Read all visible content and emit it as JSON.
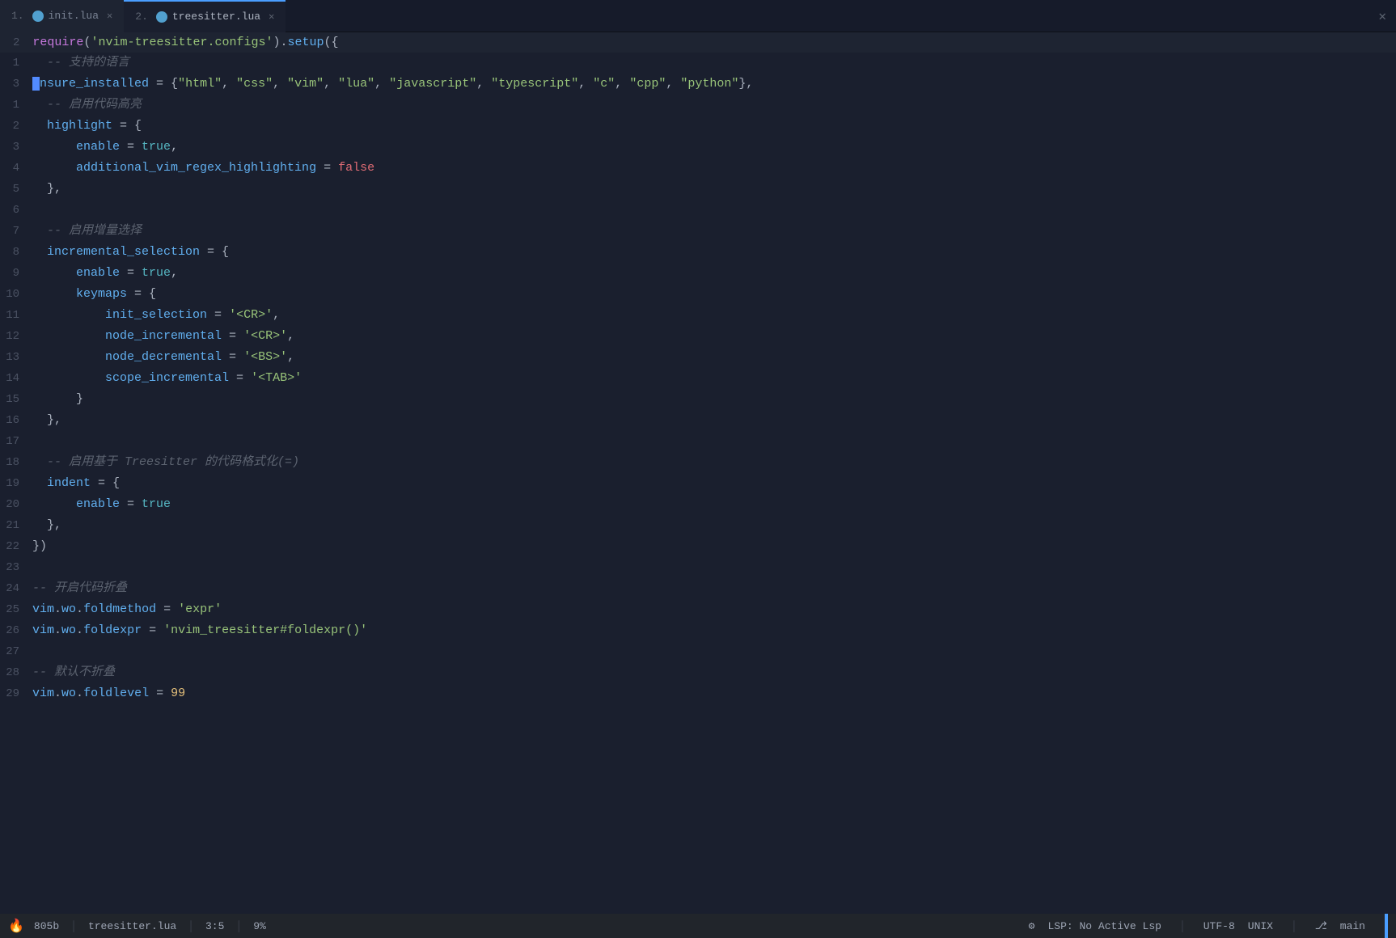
{
  "tabs": [
    {
      "id": "tab1",
      "number": "1.",
      "icon_color": "#51a0cf",
      "label": "init.lua",
      "active": false
    },
    {
      "id": "tab2",
      "number": "2.",
      "icon_color": "#51a0cf",
      "label": "treesitter.lua",
      "active": true
    }
  ],
  "require_line": "require('nvim-treesitter.configs').setup({",
  "code_lines": [
    {
      "num": "1",
      "content": "  -- 支持的语言"
    },
    {
      "num": "3",
      "content": "  ensure_installed = {\"html\", \"css\", \"vim\", \"lua\", \"javascript\", \"typescript\", \"c\", \"cpp\", \"python\"},"
    },
    {
      "num": "1",
      "content": "  -- 启用代码高亮"
    },
    {
      "num": "2",
      "content": "  highlight = {"
    },
    {
      "num": "3",
      "content": "      enable = true,"
    },
    {
      "num": "4",
      "content": "      additional_vim_regex_highlighting = false"
    },
    {
      "num": "5",
      "content": "  },"
    },
    {
      "num": "6",
      "content": ""
    },
    {
      "num": "7",
      "content": "  -- 启用增量选择"
    },
    {
      "num": "8",
      "content": "  incremental_selection = {"
    },
    {
      "num": "9",
      "content": "      enable = true,"
    },
    {
      "num": "10",
      "content": "      keymaps = {"
    },
    {
      "num": "11",
      "content": "          init_selection = '<CR>',"
    },
    {
      "num": "12",
      "content": "          node_incremental = '<CR>',"
    },
    {
      "num": "13",
      "content": "          node_decremental = '<BS>',"
    },
    {
      "num": "14",
      "content": "          scope_incremental = '<TAB>'"
    },
    {
      "num": "15",
      "content": "      }"
    },
    {
      "num": "16",
      "content": "  },"
    },
    {
      "num": "17",
      "content": ""
    },
    {
      "num": "18",
      "content": "  -- 启用基于 Treesitter 的代码格式化(=)"
    },
    {
      "num": "19",
      "content": "  indent = {"
    },
    {
      "num": "20",
      "content": "      enable = true"
    },
    {
      "num": "21",
      "content": "  },"
    },
    {
      "num": "22",
      "content": "})"
    },
    {
      "num": "23",
      "content": ""
    },
    {
      "num": "24",
      "content": "-- 开启代码折叠"
    },
    {
      "num": "25",
      "content": "vim.wo.foldmethod = 'expr'"
    },
    {
      "num": "26",
      "content": "vim.wo.foldexpr = 'nvim_treesitter#foldexpr()'"
    },
    {
      "num": "27",
      "content": ""
    },
    {
      "num": "28",
      "content": "-- 默认不折叠"
    },
    {
      "num": "29",
      "content": "vim.wo.foldlevel = 99"
    }
  ],
  "status": {
    "fire_icon": "🔥",
    "file_size": "805b",
    "file_name": "treesitter.lua",
    "position": "3:5",
    "scroll_pct": "9%",
    "lsp_icon": "⚙",
    "lsp_text": "LSP: No Active Lsp",
    "encoding": "UTF-8",
    "line_ending": "UNIX",
    "branch_icon": "⎇",
    "branch_name": "main"
  }
}
